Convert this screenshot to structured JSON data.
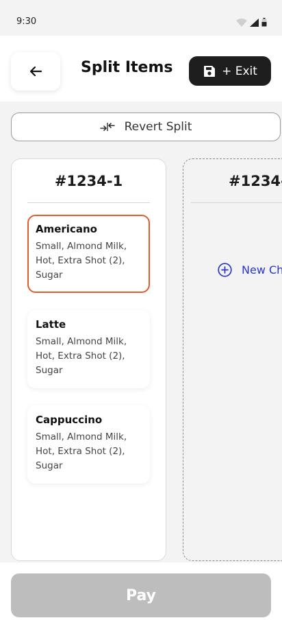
{
  "status": {
    "time": "9:30"
  },
  "header": {
    "title": "Split Items",
    "exit_label": "+ Exit"
  },
  "revert_label": "Revert Split",
  "check": {
    "title": "#1234-1",
    "items": [
      {
        "name": "Americano",
        "mods": "Small, Almond Milk, Hot, Extra Shot (2), Sugar",
        "selected": true
      },
      {
        "name": "Latte",
        "mods": "Small, Almond Milk, Hot, Extra Shot (2), Sugar",
        "selected": false
      },
      {
        "name": "Cappuccino",
        "mods": "Small, Almond Milk, Hot, Extra Shot (2), Sugar",
        "selected": false
      }
    ]
  },
  "new_check": {
    "title": "#1234-",
    "button_label": "New Ch"
  },
  "pay_label": "Pay",
  "colors": {
    "accent": "#e35a2b",
    "link": "#2a36c7",
    "disabled": "#bdbdbd",
    "dark": "#1e1e1e"
  },
  "icons": [
    "wifi-icon",
    "signal-icon",
    "battery-icon",
    "arrow-left-icon",
    "save-icon",
    "merge-arrows-icon",
    "plus-circle-icon"
  ]
}
